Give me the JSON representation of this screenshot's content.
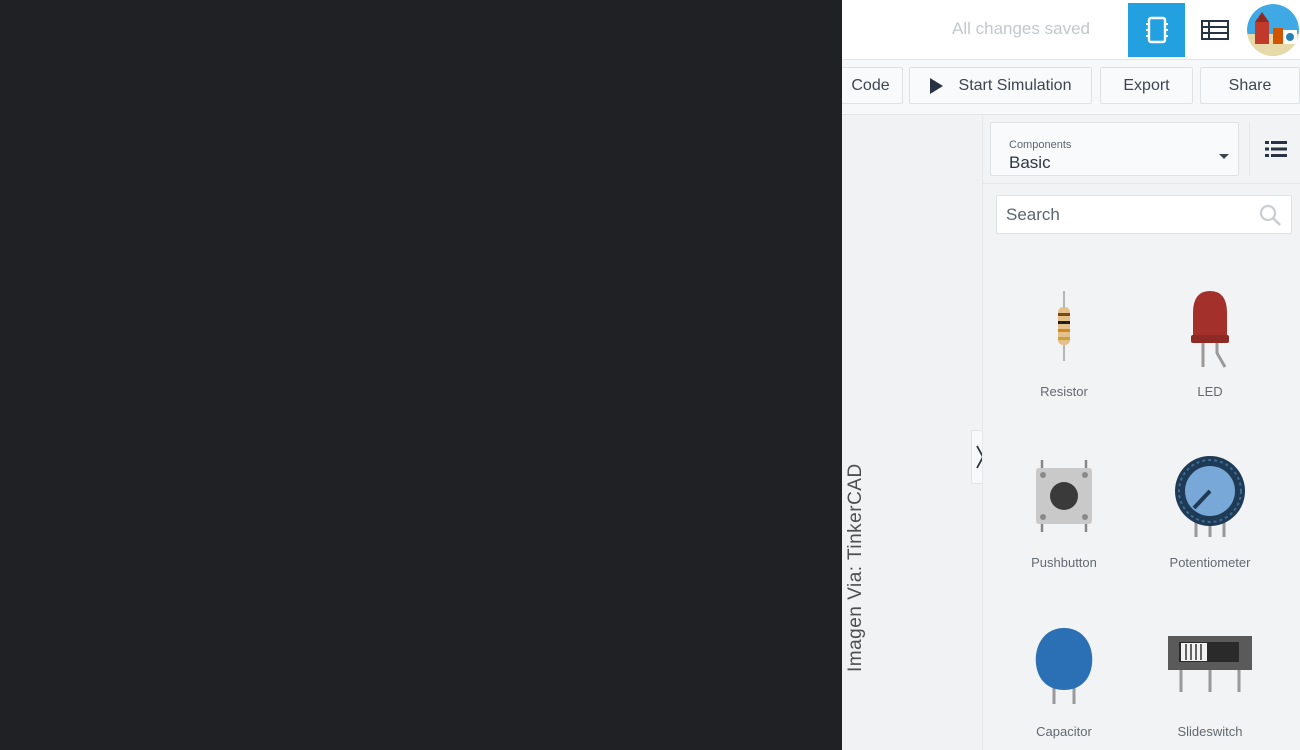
{
  "topbar": {
    "status": "All changes saved",
    "circuit_view_icon": "breadboard-chip-icon",
    "schematic_icon": "list-table-icon",
    "avatar": "user-avatar"
  },
  "toolbar": {
    "code_label": "Code",
    "start_simulation_label": "Start Simulation",
    "export_label": "Export",
    "share_label": "Share"
  },
  "components": {
    "label": "Components",
    "selected": "Basic",
    "list_view_icon": "list-view-icon"
  },
  "search": {
    "placeholder": "Search"
  },
  "items": [
    {
      "label": "Resistor",
      "icon": "resistor-icon"
    },
    {
      "label": "LED",
      "icon": "led-icon"
    },
    {
      "label": "Pushbutton",
      "icon": "pushbutton-icon"
    },
    {
      "label": "Potentiometer",
      "icon": "potentiometer-icon"
    },
    {
      "label": "Capacitor",
      "icon": "capacitor-icon"
    },
    {
      "label": "Slideswitch",
      "icon": "slideswitch-icon"
    }
  ],
  "watermark": "Imagen Via: TinkerCAD",
  "colors": {
    "accent": "#22a0e0",
    "background_dark": "#202124",
    "led_red": "#a3302b",
    "capacitor_blue": "#2b6fb5"
  }
}
